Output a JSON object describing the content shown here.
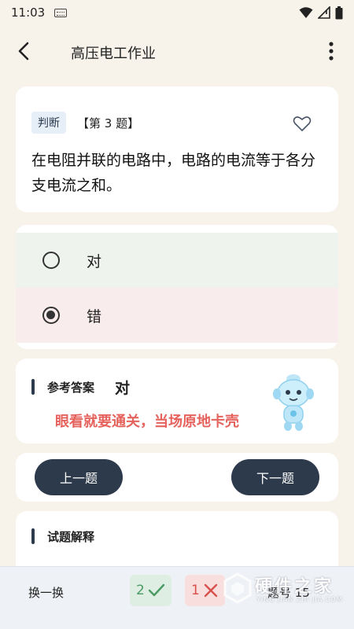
{
  "status_bar": {
    "time": "11:03"
  },
  "app_bar": {
    "title": "高压电工作业"
  },
  "question": {
    "type_badge": "判断",
    "number": "【第 3 题】",
    "text": "在电阻并联的电路中，电路的电流等于各分支电流之和。"
  },
  "options": [
    {
      "label": "对",
      "selected": false
    },
    {
      "label": "错",
      "selected": true
    }
  ],
  "answer": {
    "title": "参考答案",
    "value": "对",
    "message": "眼看就要通关，当场原地卡壳"
  },
  "nav": {
    "prev_label": "上一题",
    "next_label": "下一题"
  },
  "explanation": {
    "title": "试题解释"
  },
  "bottom_bar": {
    "switch_label": "换一换",
    "correct_count": "2",
    "wrong_count": "1",
    "question_number_label": "题号 15"
  },
  "watermark": {
    "text": "硬件之家",
    "subtext": "YING JIAN ZHI JIA.COM"
  },
  "colors": {
    "background": "#f7f3ea",
    "primary_dark": "#2d3a4b",
    "correct_bg": "#eef3ee",
    "wrong_bg": "#f9ecec",
    "answer_message": "#e5625d"
  }
}
